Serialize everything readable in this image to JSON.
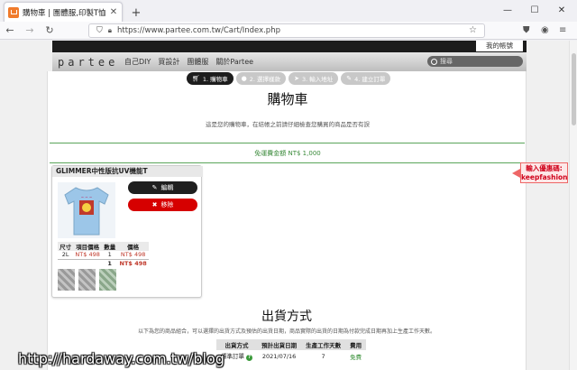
{
  "browser": {
    "tab_title": "購物車 | 團體服,印製T恤,客製化",
    "url": "https://www.partee.com.tw/Cart/Index.php",
    "new_tab_label": "+"
  },
  "site": {
    "my_account": "我的帳號",
    "logo": "partee",
    "nav": [
      "自己DIY",
      "買設計",
      "團體服",
      "關於Partee"
    ],
    "search_placeholder": "搜尋"
  },
  "steps": [
    {
      "label": "1. 購物車",
      "active": true
    },
    {
      "label": "2. 選擇樣款",
      "active": false
    },
    {
      "label": "3. 輸入地址",
      "active": false
    },
    {
      "label": "4. 建立訂單",
      "active": false
    }
  ],
  "cart": {
    "title": "購物車",
    "subtitle": "這是您的購物車，在結帳之前請仔細檢查您購買的商品是否有誤",
    "free_shipping": "免運費金額 NT$ 1,000"
  },
  "item": {
    "name": "GLIMMER中性版抗UV機能T",
    "edit_label": "編輯",
    "remove_label": "移除",
    "table_headers": [
      "尺寸",
      "項目價格",
      "數量",
      "價格"
    ],
    "rows": [
      [
        "2L",
        "NT$ 498",
        "1",
        "NT$ 498"
      ]
    ],
    "total": {
      "qty": "1",
      "price": "NT$ 498"
    },
    "colors": {
      "remove": "#d60000",
      "price": "#c0392b"
    }
  },
  "shipping": {
    "title": "出貨方式",
    "subtitle": "以下為您的商品組合，可以選擇的出貨方式及預估的出貨日期，商品實際的出貨的日期為付款完成日期再加上生產工作天數。",
    "headers": [
      "出貨方式",
      "預計出貨日期",
      "生產工作天數",
      "費用"
    ],
    "rows": [
      [
        "標準訂單",
        "2021/07/16",
        "7",
        "免費"
      ]
    ]
  },
  "coupon_note": {
    "line1": "輸入優惠碼:",
    "line2": "keepfashion"
  },
  "watermark": "http://hardaway.com.tw/blog"
}
